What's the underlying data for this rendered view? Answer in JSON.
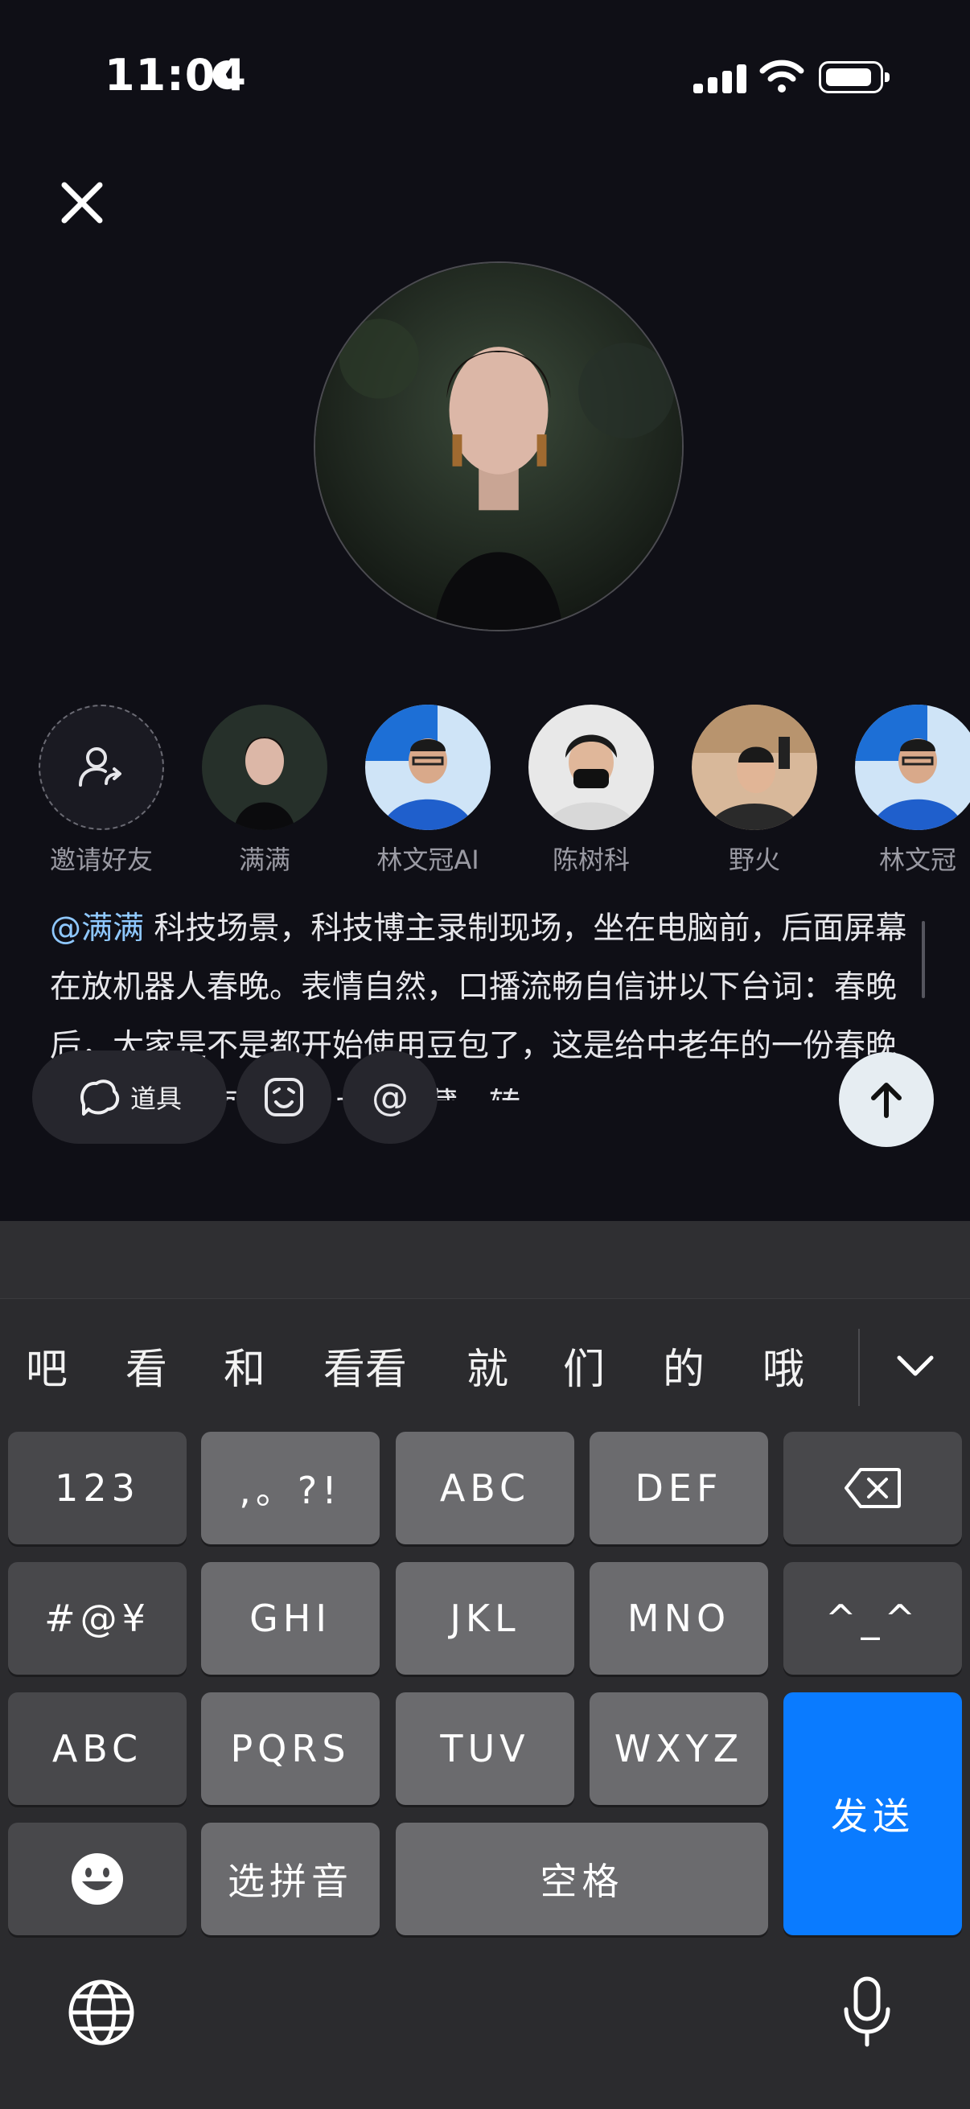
{
  "status_bar": {
    "time": "11:04"
  },
  "characters": [
    {
      "name": "邀请好友"
    },
    {
      "name": "满满"
    },
    {
      "name": "林文冠AI"
    },
    {
      "name": "陈树科"
    },
    {
      "name": "野火"
    },
    {
      "name": "林文冠"
    }
  ],
  "prompt": {
    "mention": "@满满",
    "text": " 科技场景，科技博主录制现场，坐在电脑前，后面屏幕在放机器人春晚。表情自然，口播流畅自信讲以下台词：春晚后，大家是不是都开始使用豆包了，这是给中老年的一份春晚豆包使用指南，记得点赞收藏，转"
  },
  "toolbar": {
    "tool_label": "道具",
    "at_label": "@"
  },
  "candidates": [
    "吧",
    "看",
    "和",
    "看看",
    "就",
    "们",
    "的",
    "哦"
  ],
  "keyboard": {
    "row1": [
      "123",
      ",。?!",
      "ABC",
      "DEF"
    ],
    "row2": [
      "#@¥",
      "GHI",
      "JKL",
      "MNO",
      "^_^"
    ],
    "row3": [
      "ABC",
      "PQRS",
      "TUV",
      "WXYZ"
    ],
    "row4_pinyin": "选拼音",
    "space": "空格",
    "send": "发送"
  },
  "colors": {
    "accent_blue": "#0a7bff",
    "mention": "#8fc8ff",
    "background": "#0f0f16"
  }
}
